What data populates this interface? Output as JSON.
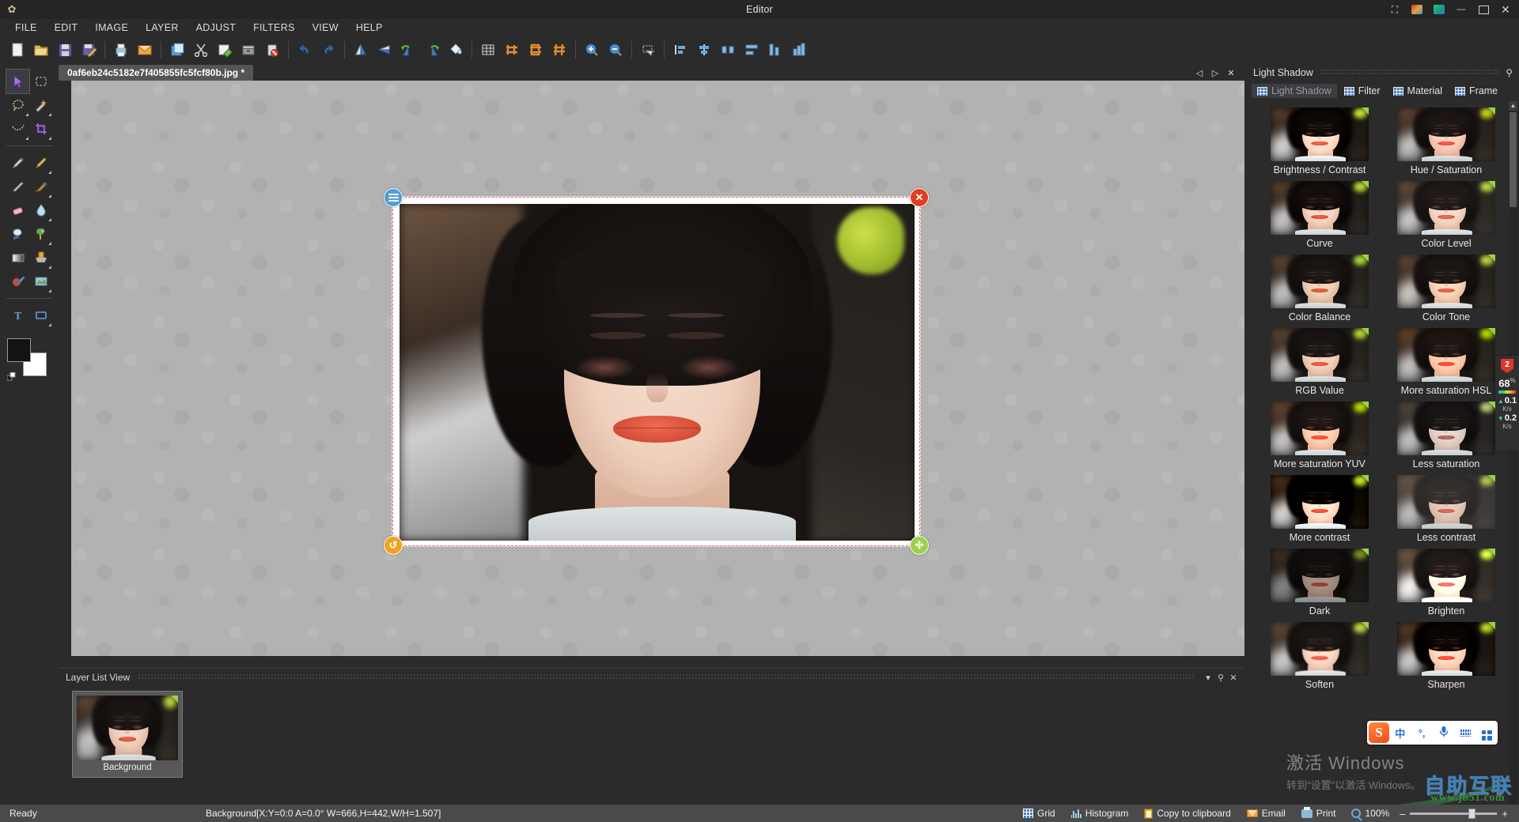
{
  "window": {
    "title": "Editor",
    "logo_icon": "flower-logo-icon",
    "controls": [
      {
        "name": "expand-icon",
        "glyph": "⛶"
      },
      {
        "name": "app-icon-1",
        "glyph": "▦"
      },
      {
        "name": "app-icon-2",
        "glyph": "▩"
      },
      {
        "name": "minimize-button",
        "glyph": "—"
      },
      {
        "name": "maximize-button",
        "glyph": "▭"
      },
      {
        "name": "close-button",
        "glyph": "✕"
      }
    ]
  },
  "menubar": {
    "items": [
      "FILE",
      "EDIT",
      "IMAGE",
      "LAYER",
      "ADJUST",
      "FILTERS",
      "VIEW",
      "HELP"
    ]
  },
  "toolbar": {
    "groups": [
      [
        "new-document-icon",
        "open-folder-icon",
        "save-icon",
        "save-as-icon"
      ],
      [
        "print-icon",
        "email-icon"
      ],
      [
        "copy-layer-icon",
        "cut-scissors-icon",
        "paste-icon",
        "archive-icon",
        "delete-icon"
      ],
      [
        "undo-icon",
        "redo-icon"
      ],
      [
        "flip-vertical-icon",
        "flip-horizontal-icon",
        "rotate-left-icon",
        "rotate-right-icon",
        "fill-bucket-icon"
      ],
      [
        "grid-icon",
        "transform-orange-icon-1",
        "transform-orange-icon-2",
        "transform-orange-icon-3"
      ],
      [
        "zoom-in-icon",
        "zoom-out-icon"
      ],
      [
        "select-rect-icon"
      ],
      [
        "align-left-icon",
        "align-center-icon"
      ],
      [
        "distribute-icon-1",
        "distribute-icon-2",
        "distribute-icon-3",
        "distribute-icon-4"
      ]
    ]
  },
  "tools": {
    "rows": [
      [
        {
          "name": "move-tool",
          "glyph": "➤",
          "active": true
        },
        {
          "name": "rect-select-tool",
          "glyph": "⬚",
          "active": false
        }
      ],
      [
        {
          "name": "lasso-tool",
          "glyph": "◌",
          "active": false
        },
        {
          "name": "magic-wand-tool",
          "glyph": "✦",
          "active": false
        }
      ],
      [
        {
          "name": "free-select-tool",
          "glyph": "〰",
          "active": false
        },
        {
          "name": "crop-tool",
          "glyph": "⛶",
          "active": false
        }
      ]
    ],
    "rows2": [
      [
        {
          "name": "pen-tool",
          "glyph": "✒"
        },
        {
          "name": "pencil-tool",
          "glyph": "✏"
        }
      ],
      [
        {
          "name": "brush-tool",
          "glyph": "🖌"
        },
        {
          "name": "airbrush-tool",
          "glyph": "🖊"
        }
      ],
      [
        {
          "name": "eraser-tool",
          "glyph": "▱"
        },
        {
          "name": "water-drop-tool",
          "glyph": "💧"
        }
      ],
      [
        {
          "name": "smudge-tool",
          "glyph": "☁"
        },
        {
          "name": "color-replace-tool",
          "glyph": "✚"
        }
      ],
      [
        {
          "name": "gradient-tool",
          "glyph": "▤"
        },
        {
          "name": "clone-stamp-tool",
          "glyph": "⬆"
        }
      ],
      [
        {
          "name": "color-picker-tool",
          "glyph": "◉"
        },
        {
          "name": "texture-tool",
          "glyph": "▨"
        }
      ]
    ],
    "rows3": [
      [
        {
          "name": "text-tool",
          "glyph": "T"
        },
        {
          "name": "shape-tool",
          "glyph": "▭"
        }
      ]
    ],
    "colors": {
      "foreground": "#131313",
      "background": "#ffffff"
    }
  },
  "document": {
    "tab_label": "0af6eb24c5182e7f405855fc5fcf80b.jpg *",
    "tab_controls": [
      "◁",
      "▷",
      "✕"
    ]
  },
  "layer_panel": {
    "title": "Layer List View",
    "controls": [
      "▾",
      "📌",
      "✕"
    ],
    "layers": [
      {
        "name": "Background"
      }
    ]
  },
  "right_panel": {
    "title": "Light Shadow",
    "pin_icon": "pin-icon",
    "tabs": [
      {
        "label": "Light Shadow",
        "active": true
      },
      {
        "label": "Filter",
        "active": false
      },
      {
        "label": "Material",
        "active": false
      },
      {
        "label": "Frame",
        "active": false
      }
    ],
    "effects": [
      {
        "label": "Brightness / Contrast",
        "css": "f-bc"
      },
      {
        "label": "Hue / Saturation",
        "css": "f-hs"
      },
      {
        "label": "Curve",
        "css": "f-cv"
      },
      {
        "label": "Color Level",
        "css": "f-cl"
      },
      {
        "label": "Color Balance",
        "css": "f-cb"
      },
      {
        "label": "Color Tone",
        "css": "f-ct"
      },
      {
        "label": "RGB Value",
        "css": "f-rgb"
      },
      {
        "label": "More saturation HSL",
        "css": "f-hsl"
      },
      {
        "label": "More saturation YUV",
        "css": "f-yuv"
      },
      {
        "label": "Less saturation",
        "css": "f-less"
      },
      {
        "label": "More contrast",
        "css": "f-morec"
      },
      {
        "label": "Less contrast",
        "css": "f-lessc"
      },
      {
        "label": "Dark",
        "css": "f-dark"
      },
      {
        "label": "Brighten",
        "css": "f-bright"
      },
      {
        "label": "Soften",
        "css": "f-soft"
      },
      {
        "label": "Sharpen",
        "css": "f-sharp"
      }
    ]
  },
  "net_widget": {
    "badge": "2",
    "percent": "68",
    "percent_unit": "%",
    "upload_value": "0.1",
    "upload_unit": "K/s",
    "download_value": "0.2",
    "download_unit": "K/s"
  },
  "ime_bar": {
    "logo": "S",
    "items": [
      "中",
      "°,"
    ],
    "mic_icon": "microphone-icon",
    "keyboard_icon": "keyboard-icon",
    "apps_icon": "apps-grid-icon"
  },
  "watermarks": {
    "windows_line1": "激活 Windows",
    "windows_line2": "转到\"设置\"以激活 Windows。",
    "site_cn": "自助互联",
    "site_url": "www.jb51.com"
  },
  "statusbar": {
    "ready": "Ready",
    "info": "Background[X:Y=0:0 A=0.0° W=666,H=442,W/H=1.507]",
    "buttons": [
      {
        "label": "Grid",
        "icon": "grid-icon"
      },
      {
        "label": "Histogram",
        "icon": "histogram-icon"
      },
      {
        "label": "Copy to clipboard",
        "icon": "clipboard-icon"
      },
      {
        "label": "Email",
        "icon": "email-icon"
      },
      {
        "label": "Print",
        "icon": "print-icon"
      }
    ],
    "zoom": "100%",
    "zoom_minus": "–",
    "zoom_plus": "+"
  },
  "canvas": {
    "selection_handles": [
      {
        "name": "layer-menu-handle",
        "glyph": ""
      },
      {
        "name": "close-selection-handle",
        "glyph": "✕"
      },
      {
        "name": "rotate-handle",
        "glyph": "↺"
      },
      {
        "name": "scale-handle",
        "glyph": "✣"
      }
    ]
  }
}
